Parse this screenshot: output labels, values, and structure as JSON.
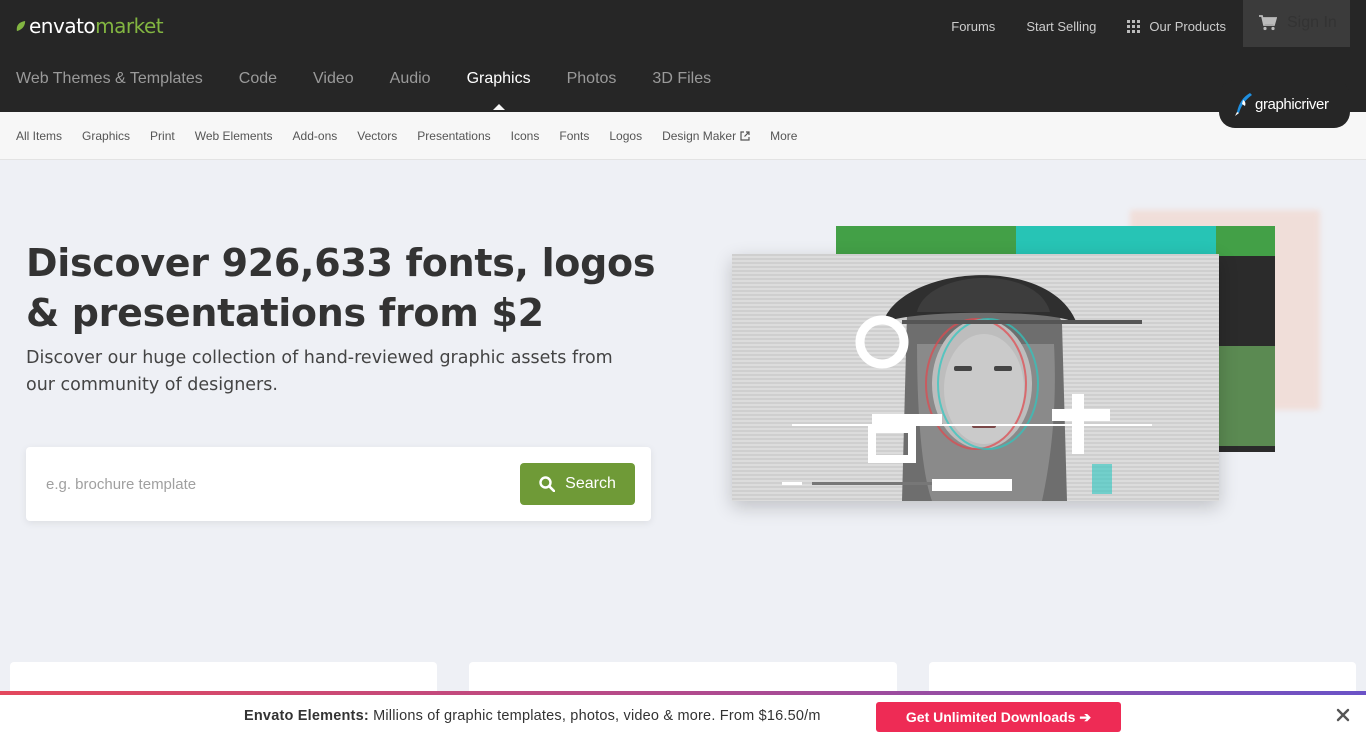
{
  "brand": {
    "word1": "envato",
    "word2": "market",
    "green": "#82b541"
  },
  "topbar": {
    "links": [
      "Forums",
      "Start Selling",
      "Our Products"
    ],
    "signin": "Sign In"
  },
  "main_nav": [
    {
      "label": "Web Themes & Templates",
      "active": false
    },
    {
      "label": "Code",
      "active": false
    },
    {
      "label": "Video",
      "active": false
    },
    {
      "label": "Audio",
      "active": false
    },
    {
      "label": "Graphics",
      "active": true
    },
    {
      "label": "Photos",
      "active": false
    },
    {
      "label": "3D Files",
      "active": false
    }
  ],
  "badge": {
    "label": "graphicriver"
  },
  "sub_nav": [
    "All Items",
    "Graphics",
    "Print",
    "Web Elements",
    "Add-ons",
    "Vectors",
    "Presentations",
    "Icons",
    "Fonts",
    "Logos",
    "Design Maker",
    "More"
  ],
  "hero": {
    "title": "Discover 926,633 fonts, logos & presentations from $2",
    "subtitle": "Discover our huge collection of hand-reviewed graphic assets from our community of designers."
  },
  "search": {
    "placeholder": "e.g. brochure template",
    "button": "Search",
    "button_color": "#6f9a37"
  },
  "bottom_banner": {
    "lead": "Envato Elements:",
    "text": " Millions of graphic templates, photos, video & more. From $16.50/m",
    "cta": "Get Unlimited Downloads ➔",
    "cta_color": "#ee2b55"
  },
  "icons": [
    "leaf-icon",
    "grid-icon",
    "cart-icon",
    "quill-icon",
    "external-link-icon",
    "search-icon",
    "close-icon"
  ]
}
